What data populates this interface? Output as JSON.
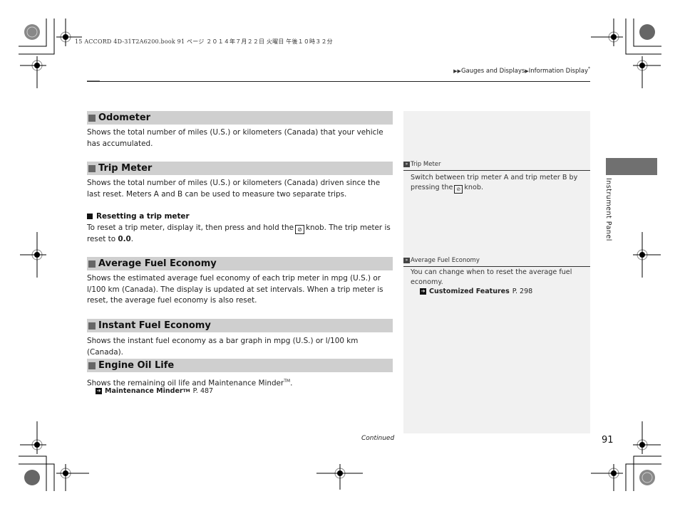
{
  "print_header": "15 ACCORD 4D-31T2A6200.book  91 ページ  ２０１４年７月２２日  火曜日  午後１０時３２分",
  "breadcrumb": {
    "items": [
      "Gauges and Displays",
      "Information Display"
    ],
    "asterisk": "*"
  },
  "sections": [
    {
      "title": "Odometer",
      "body": "Shows the total number of miles (U.S.) or kilometers (Canada) that your vehicle has accumulated."
    },
    {
      "title": "Trip Meter",
      "body": "Shows the total number of miles (U.S.) or kilometers (Canada) driven since the last reset. Meters A and B can be used to measure two separate trips.",
      "subsection": {
        "title": "Resetting a trip meter",
        "body_before_icon": "To reset a trip meter, display it, then press and hold the",
        "icon": "select-reset-knob-icon",
        "body_after_icon": "knob. The trip meter is reset to",
        "value": "0.0",
        "end": "."
      }
    },
    {
      "title": "Average Fuel Economy",
      "body": "Shows the estimated average fuel economy of each trip meter in mpg (U.S.) or l/100 km (Canada). The display is updated at set intervals. When a trip meter is reset, the average fuel economy is also reset."
    },
    {
      "title": "Instant Fuel Economy",
      "body": "Shows the instant fuel economy as a bar graph in mpg (U.S.) or l/100 km (Canada)."
    },
    {
      "title": "Engine Oil Life",
      "body": "Shows the remaining oil life and Maintenance Minder",
      "body_tm": "TM",
      "body_end": ".",
      "xref": {
        "label": "Maintenance Minder",
        "tm": "TM",
        "page": "P. 487"
      }
    }
  ],
  "sidebar_notes": [
    {
      "title": "Trip Meter",
      "body_before_icon": "Switch between trip meter A and trip meter B by pressing the",
      "icon": "select-reset-knob-icon",
      "body_after_icon": "knob."
    },
    {
      "title": "Average Fuel Economy",
      "body": "You can change when to reset the average fuel economy.",
      "xref": {
        "label": "Customized Features",
        "page": "P. 298"
      }
    }
  ],
  "chapter_tab": "Instrument Panel",
  "footer": {
    "continued": "Continued",
    "page_number": "91"
  }
}
